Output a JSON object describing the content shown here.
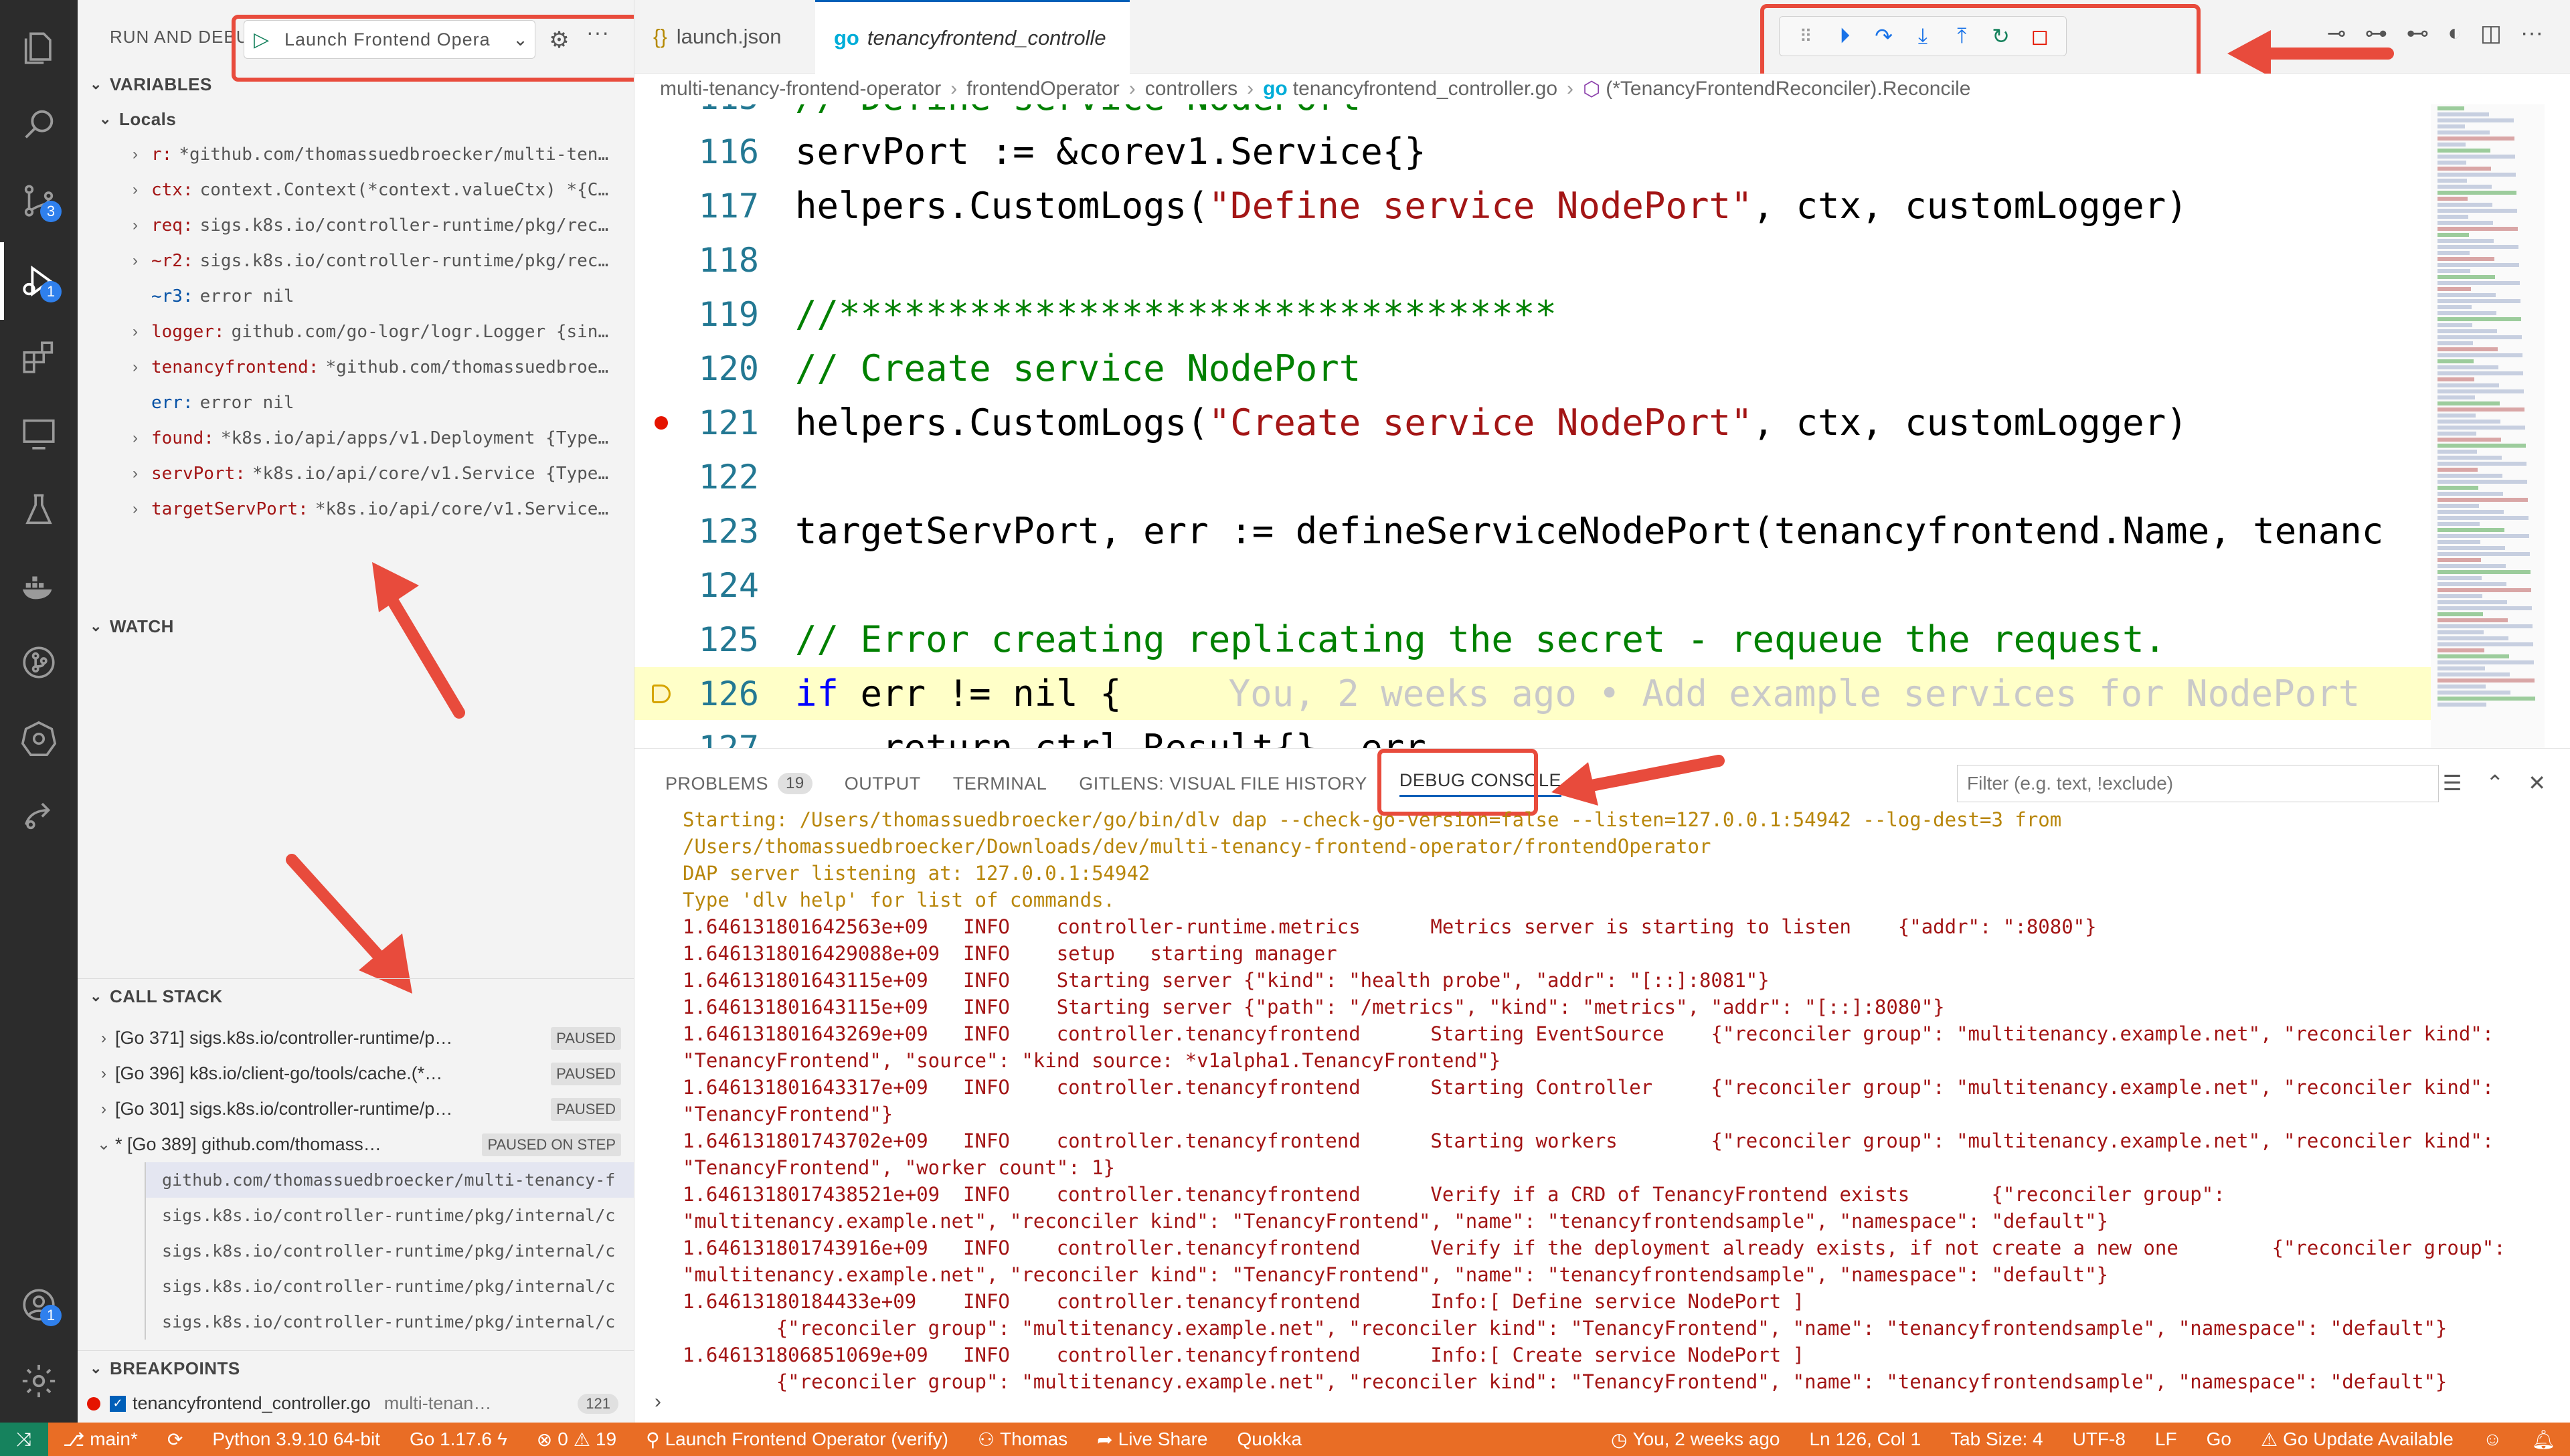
{
  "activity": {
    "scm_badge": "3",
    "debug_badge": "1",
    "account_badge": "1"
  },
  "sidebar": {
    "title": "RUN AND DEBUG",
    "launch_config": "Launch Frontend Opera",
    "variables_title": "VARIABLES",
    "locals_title": "Locals",
    "variables": [
      {
        "name": "r:",
        "value": "*github.com/thomassuedbroecker/multi-ten…",
        "expandable": true
      },
      {
        "name": "ctx:",
        "value": "context.Context(*context.valueCtx) *{C…",
        "expandable": true
      },
      {
        "name": "req:",
        "value": "sigs.k8s.io/controller-runtime/pkg/rec…",
        "expandable": true
      },
      {
        "name": "~r2:",
        "value": "sigs.k8s.io/controller-runtime/pkg/rec…",
        "expandable": true
      },
      {
        "name": "~r3:",
        "value": "error nil",
        "expandable": false
      },
      {
        "name": "logger:",
        "value": "github.com/go-logr/logr.Logger {sin…",
        "expandable": true
      },
      {
        "name": "tenancyfrontend:",
        "value": "*github.com/thomassuedbroe…",
        "expandable": true
      },
      {
        "name": "err:",
        "value": "error nil",
        "expandable": false
      },
      {
        "name": "found:",
        "value": "*k8s.io/api/apps/v1.Deployment {Type…",
        "expandable": true
      },
      {
        "name": "servPort:",
        "value": "*k8s.io/api/core/v1.Service {Type…",
        "expandable": true
      },
      {
        "name": "targetServPort:",
        "value": "*k8s.io/api/core/v1.Service…",
        "expandable": true
      }
    ],
    "watch_title": "WATCH",
    "callstack_title": "CALL STACK",
    "threads": [
      {
        "label": "[Go 371] sigs.k8s.io/controller-runtime/p…",
        "state": "PAUSED"
      },
      {
        "label": "[Go 396] k8s.io/client-go/tools/cache.(*…",
        "state": "PAUSED"
      },
      {
        "label": "[Go 301] sigs.k8s.io/controller-runtime/p…",
        "state": "PAUSED"
      },
      {
        "label": "* [Go 389] github.com/thomass…",
        "state": "PAUSED ON STEP"
      }
    ],
    "frames": [
      "github.com/thomassuedbroecker/multi-tenancy-f",
      "sigs.k8s.io/controller-runtime/pkg/internal/c",
      "sigs.k8s.io/controller-runtime/pkg/internal/c",
      "sigs.k8s.io/controller-runtime/pkg/internal/c",
      "sigs.k8s.io/controller-runtime/pkg/internal/c"
    ],
    "breakpoints_title": "BREAKPOINTS",
    "breakpoint": {
      "file": "tenancyfrontend_controller.go",
      "path": "multi-tenan…",
      "line": "121"
    }
  },
  "tabs": [
    {
      "label": "launch.json",
      "icon": "{}"
    },
    {
      "label": "tenancyfrontend_controlle",
      "icon": "go"
    }
  ],
  "breadcrumb": [
    "multi-tenancy-frontend-operator",
    "frontendOperator",
    "controllers",
    "tenancyfrontend_controller.go",
    "(*TenancyFrontendReconciler).Reconcile"
  ],
  "editor": {
    "lines": [
      {
        "n": "115",
        "code": "// Define service NodePort"
      },
      {
        "n": "116",
        "code": "servPort := &corev1.Service{}"
      },
      {
        "n": "117",
        "pre": "helpers.CustomLogs(",
        "str": "\"Define service NodePort\"",
        "post": ", ctx, customLogger)"
      },
      {
        "n": "118",
        "code": ""
      },
      {
        "n": "119",
        "code": "//*********************************"
      },
      {
        "n": "120",
        "code": "// Create service NodePort"
      },
      {
        "n": "121",
        "pre": "helpers.CustomLogs(",
        "str": "\"Create service NodePort\"",
        "post": ", ctx, customLogger)"
      },
      {
        "n": "122",
        "code": ""
      },
      {
        "n": "123",
        "code": "targetServPort, err := defineServiceNodePort(tenancyfrontend.Name, tenanc"
      },
      {
        "n": "124",
        "code": ""
      },
      {
        "n": "125",
        "code": "// Error creating replicating the secret - requeue the request."
      },
      {
        "n": "126",
        "kw": "if",
        "post": " err != nil {",
        "blame": "You, 2 weeks ago • Add example services for NodePort"
      },
      {
        "n": "127",
        "code": "    return ctrl.Result{}, err"
      }
    ]
  },
  "panel": {
    "tabs": [
      {
        "label": "PROBLEMS",
        "count": "19"
      },
      {
        "label": "OUTPUT"
      },
      {
        "label": "TERMINAL"
      },
      {
        "label": "GITLENS: VISUAL FILE HISTORY"
      },
      {
        "label": "DEBUG CONSOLE"
      }
    ],
    "filter_placeholder": "Filter (e.g. text, !exclude)",
    "console": [
      {
        "c": "y",
        "t": "Starting: /Users/thomassuedbroecker/go/bin/dlv dap --check-go-version=false --listen=127.0.0.1:54942 --log-dest=3 from /Users/thomassuedbroecker/Downloads/dev/multi-tenancy-frontend-operator/frontendOperator"
      },
      {
        "c": "y",
        "t": "DAP server listening at: 127.0.0.1:54942"
      },
      {
        "c": "y",
        "t": "Type 'dlv help' for list of commands."
      },
      {
        "c": "r",
        "t": "1.646131801642563e+09   INFO    controller-runtime.metrics      Metrics server is starting to listen    {\"addr\": \":8080\"}"
      },
      {
        "c": "r",
        "t": "1.6461318016429088e+09  INFO    setup   starting manager"
      },
      {
        "c": "r",
        "t": "1.646131801643115e+09   INFO    Starting server {\"kind\": \"health probe\", \"addr\": \"[::]:8081\"}"
      },
      {
        "c": "r",
        "t": "1.646131801643115e+09   INFO    Starting server {\"path\": \"/metrics\", \"kind\": \"metrics\", \"addr\": \"[::]:8080\"}"
      },
      {
        "c": "r",
        "t": "1.646131801643269e+09   INFO    controller.tenancyfrontend      Starting EventSource    {\"reconciler group\": \"multitenancy.example.net\", \"reconciler kind\": \"TenancyFrontend\", \"source\": \"kind source: *v1alpha1.TenancyFrontend\"}"
      },
      {
        "c": "r",
        "t": "1.646131801643317e+09   INFO    controller.tenancyfrontend      Starting Controller     {\"reconciler group\": \"multitenancy.example.net\", \"reconciler kind\": \"TenancyFrontend\"}"
      },
      {
        "c": "r",
        "t": "1.646131801743702e+09   INFO    controller.tenancyfrontend      Starting workers        {\"reconciler group\": \"multitenancy.example.net\", \"reconciler kind\": \"TenancyFrontend\", \"worker count\": 1}"
      },
      {
        "c": "r",
        "t": "1.6461318017438521e+09  INFO    controller.tenancyfrontend      Verify if a CRD of TenancyFrontend exists       {\"reconciler group\": \"multitenancy.example.net\", \"reconciler kind\": \"TenancyFrontend\", \"name\": \"tenancyfrontendsample\", \"namespace\": \"default\"}"
      },
      {
        "c": "r",
        "t": "1.646131801743916e+09   INFO    controller.tenancyfrontend      Verify if the deployment already exists, if not create a new one        {\"reconciler group\": \"multitenancy.example.net\", \"reconciler kind\": \"TenancyFrontend\", \"name\": \"tenancyfrontendsample\", \"namespace\": \"default\"}"
      },
      {
        "c": "r",
        "t": "1.64613180184433e+09    INFO    controller.tenancyfrontend      Info:[ Define service NodePort ]\n        {\"reconciler group\": \"multitenancy.example.net\", \"reconciler kind\": \"TenancyFrontend\", \"name\": \"tenancyfrontendsample\", \"namespace\": \"default\"}"
      },
      {
        "c": "r",
        "t": "1.646131806851069e+09   INFO    controller.tenancyfrontend      Info:[ Create service NodePort ]\n        {\"reconciler group\": \"multitenancy.example.net\", \"reconciler kind\": \"TenancyFrontend\", \"name\": \"tenancyfrontendsample\", \"namespace\": \"default\"}"
      }
    ]
  },
  "status": {
    "branch": "main*",
    "python": "Python 3.9.10 64-bit",
    "go": "Go 1.17.6",
    "errors": "0",
    "warnings": "19",
    "launch": "Launch Frontend Operator (verify)",
    "user": "Thomas",
    "live_share": "Live Share",
    "quokka": "Quokka",
    "blame": "You, 2 weeks ago",
    "position": "Ln 126, Col 1",
    "tab_size": "Tab Size: 4",
    "encoding": "UTF-8",
    "eol": "LF",
    "lang": "Go",
    "update": "Go Update Available"
  }
}
